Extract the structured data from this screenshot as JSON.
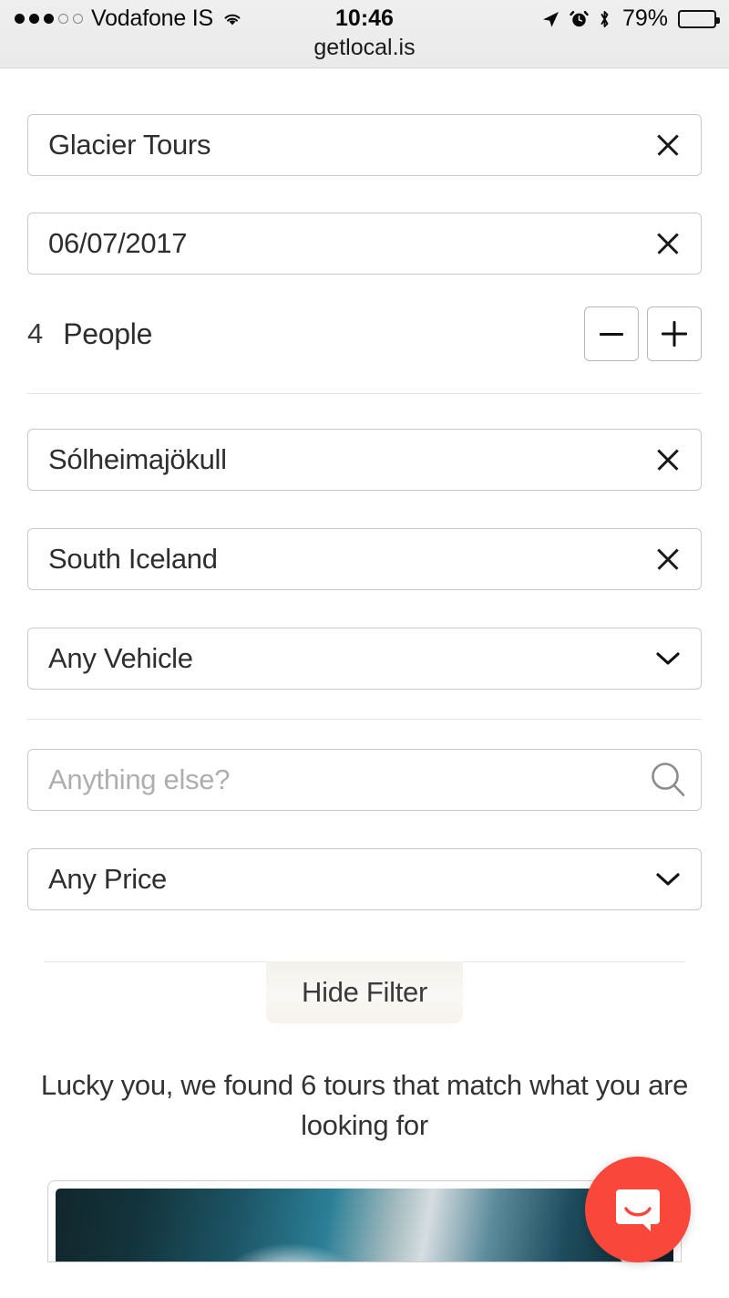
{
  "status_bar": {
    "signal_dots_filled": 3,
    "signal_dots_total": 5,
    "carrier": "Vodafone IS",
    "wifi_icon": "wifi-icon",
    "time": "10:46",
    "location_icon": "location-arrow-icon",
    "alarm_icon": "alarm-clock-icon",
    "bluetooth_icon": "bluetooth-icon",
    "battery_percent": "79%",
    "battery_level": 79,
    "url": "getlocal.is"
  },
  "filters": {
    "tour_type": {
      "value": "Glacier Tours",
      "clear_icon": "close-icon"
    },
    "date": {
      "value": "06/07/2017",
      "clear_icon": "close-icon"
    },
    "people": {
      "count": "4",
      "label": "People",
      "decrement": "−",
      "increment": "+"
    },
    "location": {
      "value": "Sólheimajökull",
      "clear_icon": "close-icon"
    },
    "region": {
      "value": "South Iceland",
      "clear_icon": "close-icon"
    },
    "vehicle": {
      "value": "Any Vehicle",
      "chevron_icon": "chevron-down-icon"
    },
    "keyword": {
      "value": "",
      "placeholder": "Anything else?",
      "search_icon": "search-icon"
    },
    "price": {
      "value": "Any Price",
      "chevron_icon": "chevron-down-icon"
    }
  },
  "filter_toggle": {
    "label": "Hide Filter"
  },
  "results": {
    "message": "Lucky you, we found 6 tours that match what you are looking for",
    "count": 6
  },
  "tour_card": {
    "favorite_icon": "heart-icon"
  },
  "intercom": {
    "icon": "chat-bubble-icon",
    "color": "#f9473b"
  },
  "colors": {
    "status_bar_bg": "#ececec",
    "field_border": "#c9c9c9",
    "text": "#2e2e2e",
    "placeholder": "#aeaeae",
    "divider": "#e4e4e4",
    "hide_filter_bg": "#f8f6f1",
    "intercom_red": "#f9473b"
  }
}
